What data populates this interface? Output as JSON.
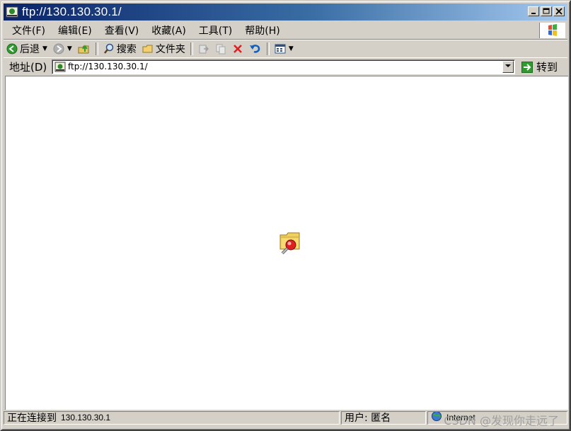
{
  "window": {
    "title": "ftp://130.130.30.1/",
    "caption_buttons": {
      "minimize": "_",
      "maximize": "□",
      "close": "×"
    }
  },
  "menubar": {
    "items": [
      "文件(F)",
      "编辑(E)",
      "查看(V)",
      "收藏(A)",
      "工具(T)",
      "帮助(H)"
    ]
  },
  "toolbar": {
    "back_label": "后退",
    "search_label": "搜索",
    "folders_label": "文件夹",
    "icons": [
      "back-arrow-icon",
      "forward-arrow-icon",
      "up-folder-icon",
      "search-icon",
      "folders-icon",
      "move-to-icon",
      "copy-to-icon",
      "delete-icon",
      "undo-icon",
      "views-icon"
    ]
  },
  "addressbar": {
    "label": "地址(D)",
    "url": "ftp://130.130.30.1/",
    "go_label": "转到"
  },
  "statusbar": {
    "connecting_label": "正在连接到",
    "connecting_host": "130.130.30.1",
    "user_label": "用户: 匿名",
    "zone_label": "Internet"
  },
  "watermark": "CSDN @发现你走远了",
  "colors": {
    "titlebar_start": "#0a246a",
    "titlebar_end": "#a6caf0",
    "chrome": "#d4d0c8",
    "back_green": "#2f9a2f",
    "delete_red": "#e02020",
    "undo_blue": "#1060c0"
  }
}
